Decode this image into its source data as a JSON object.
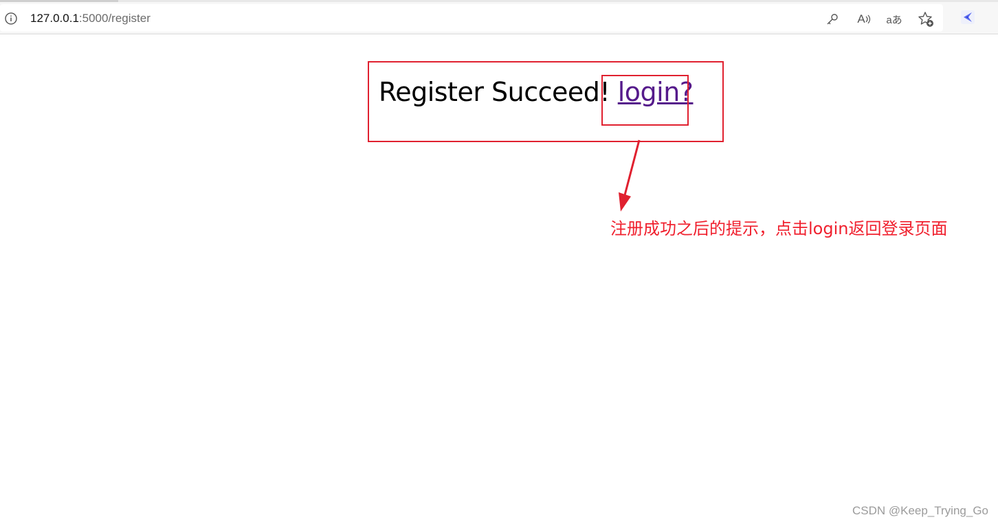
{
  "browser": {
    "url_host": "127.0.0.1",
    "url_path": ":5000/register",
    "icons": [
      "info-icon",
      "key-icon",
      "read-aloud-icon",
      "translate-icon",
      "add-favorite-icon",
      "extension-icon"
    ],
    "read_aloud_glyph": "A",
    "translate_glyph": "aあ"
  },
  "page": {
    "message": "Register Succeed!",
    "login_link": "login?"
  },
  "annotation": {
    "text": "注册成功之后的提示，点击login返回登录页面",
    "color": "#e0202f"
  },
  "watermark": "CSDN @Keep_Trying_Go"
}
